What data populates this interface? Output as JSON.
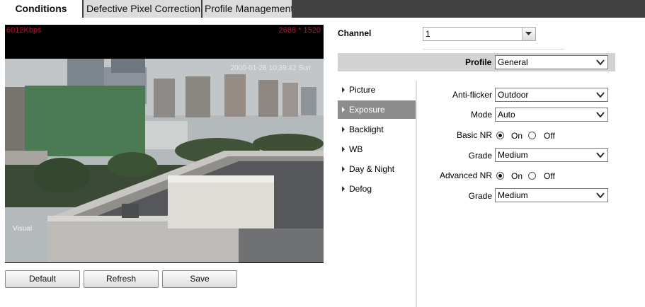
{
  "tabs": [
    {
      "label": "Conditions",
      "active": true
    },
    {
      "label": "Defective Pixel Correction",
      "active": false
    },
    {
      "label": "Profile Management",
      "active": false
    }
  ],
  "video": {
    "bitrate": "6012Kbps",
    "resolution": "2688 * 1520",
    "timestamp": "2000-01-28 10:39:42 Sun",
    "channel_name": "Visual"
  },
  "buttons": {
    "default": "Default",
    "refresh": "Refresh",
    "save": "Save"
  },
  "channel": {
    "label": "Channel",
    "value": "1"
  },
  "profile": {
    "label": "Profile",
    "value": "General"
  },
  "menu": [
    {
      "label": "Picture",
      "active": false
    },
    {
      "label": "Exposure",
      "active": true
    },
    {
      "label": "Backlight",
      "active": false
    },
    {
      "label": "WB",
      "active": false
    },
    {
      "label": "Day & Night",
      "active": false
    },
    {
      "label": "Defog",
      "active": false
    }
  ],
  "settings": {
    "anti_flicker": {
      "label": "Anti-flicker",
      "value": "Outdoor"
    },
    "mode": {
      "label": "Mode",
      "value": "Auto"
    },
    "basic_nr": {
      "label": "Basic NR",
      "on_label": "On",
      "off_label": "Off",
      "selected": "On"
    },
    "basic_grade": {
      "label": "Grade",
      "value": "Medium"
    },
    "advanced_nr": {
      "label": "Advanced NR",
      "on_label": "On",
      "off_label": "Off",
      "selected": "On"
    },
    "advanced_grade": {
      "label": "Grade",
      "value": "Medium"
    }
  },
  "colors": {
    "active_menu": "#8d8d8d",
    "tabbar": "#414141",
    "osd_red": "#c8102e"
  }
}
